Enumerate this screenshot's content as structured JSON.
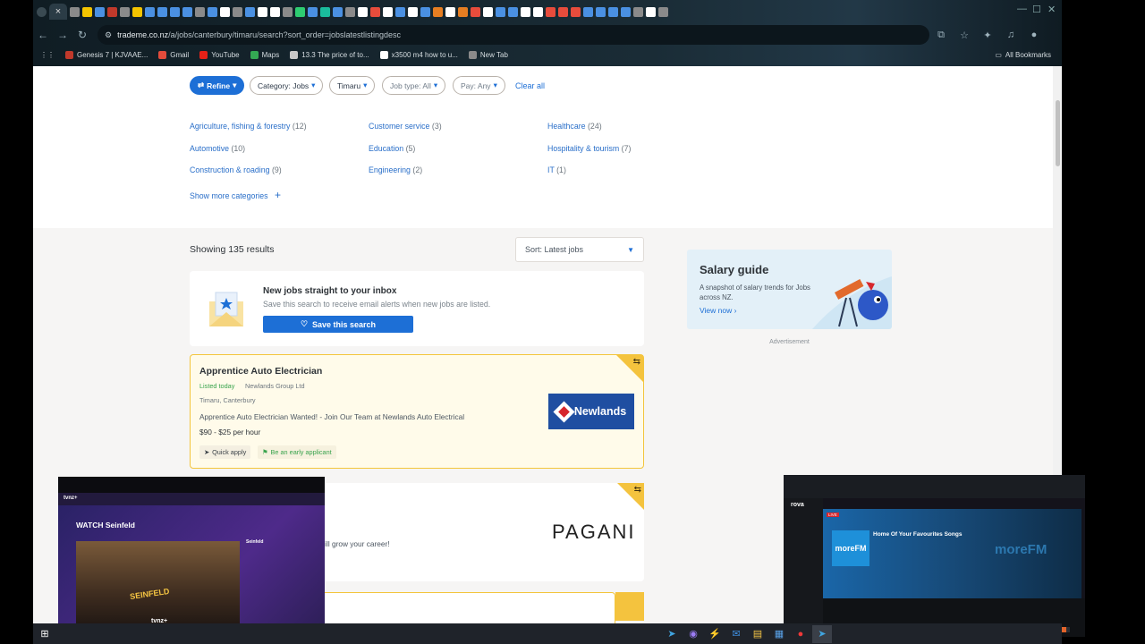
{
  "browser": {
    "url_host": "trademe.co.nz",
    "url_path": "/a/jobs/canterbury/timaru/search?sort_order=jobslatestlistingdesc",
    "close_tab_glyph": "×",
    "bookmarks": [
      {
        "label": "Genesis 7 | KJVAAE...",
        "icon": "bookmark-icon",
        "color": "#c0392b"
      },
      {
        "label": "Gmail",
        "icon": "gmail-icon",
        "color": "#e24b3b"
      },
      {
        "label": "YouTube",
        "icon": "youtube-icon",
        "color": "#e62117"
      },
      {
        "label": "Maps",
        "icon": "maps-icon",
        "color": "#34a853"
      },
      {
        "label": "13.3 The price of to...",
        "icon": "page-icon",
        "color": "#c8c8c8"
      },
      {
        "label": "x3500 m4 how to u...",
        "icon": "google-icon",
        "color": "#ffffff"
      },
      {
        "label": "New Tab",
        "icon": "newtab-icon",
        "color": "#8a8a8a"
      }
    ],
    "all_bookmarks": "All Bookmarks"
  },
  "filters": {
    "refine": "Refine",
    "category": "Category: Jobs",
    "location": "Timaru",
    "job_type": "Job type: All",
    "pay": "Pay: Any",
    "clear_all": "Clear all"
  },
  "categories": [
    {
      "name": "Agriculture, fishing & forestry",
      "count": "(12)"
    },
    {
      "name": "Customer service",
      "count": "(3)"
    },
    {
      "name": "Healthcare",
      "count": "(24)"
    },
    {
      "name": "Automotive",
      "count": "(10)"
    },
    {
      "name": "Education",
      "count": "(5)"
    },
    {
      "name": "Hospitality & tourism",
      "count": "(7)"
    },
    {
      "name": "Construction & roading",
      "count": "(9)"
    },
    {
      "name": "Engineering",
      "count": "(2)"
    },
    {
      "name": "IT",
      "count": "(1)"
    }
  ],
  "show_more": "Show more categories",
  "results": {
    "showing": "Showing 135 results",
    "sort": "Sort: Latest jobs"
  },
  "alert": {
    "title": "New jobs straight to your inbox",
    "subtitle": "Save this search to receive email alerts when new jobs are listed.",
    "button": "Save this search"
  },
  "jobs": [
    {
      "title": "Apprentice Auto Electrician",
      "listed": "Listed today",
      "company": "Newlands Group Ltd",
      "location": "Timaru, Canterbury",
      "description": "Apprentice Auto Electrician Wanted! - Join Our Team at Newlands Auto Electrical",
      "pay": "$90 - $25 per hour",
      "tag_quick": "Quick apply",
      "tag_early": "Be an early applicant",
      "logo_text": "Newlands"
    },
    {
      "description": "rt of a leading top fashion brand that will grow your career!",
      "logo_text": "PAGANI"
    }
  ],
  "salary_guide": {
    "title": "Salary guide",
    "subtitle": "A snapshot of salary trends for Jobs across NZ.",
    "link": "View now",
    "advert": "Advertisement"
  },
  "pip_left": {
    "brand": "tvnz+",
    "title": "WATCH Seinfeld",
    "show": "Seinfeld",
    "badge": "SEINFELD",
    "caption": "tvnz+"
  },
  "pip_right": {
    "brand": "rova",
    "title": "Home Of Your Favourites Songs",
    "station": "moreFM",
    "badge": "LIVE",
    "logo": "moreFM"
  }
}
